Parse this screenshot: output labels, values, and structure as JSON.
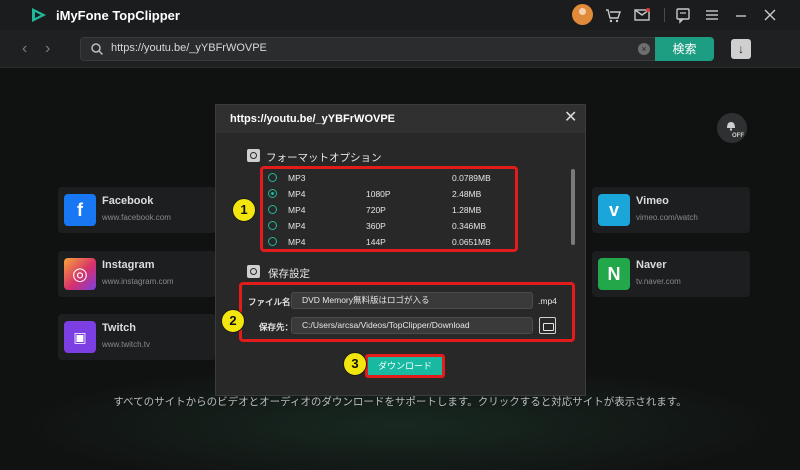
{
  "app": {
    "title": "iMyFone TopClipper",
    "brand_color": "#1d9d82",
    "icons": [
      "app-logo-icon",
      "cart-icon",
      "mail-icon",
      "feedback-icon",
      "menu-icon",
      "minimize-icon",
      "close-icon"
    ]
  },
  "addressbar": {
    "url": "https://youtu.be/_yYBFrWOVPE",
    "search_label": "検索"
  },
  "sites": [
    {
      "name": "Facebook",
      "url": "www.facebook.com",
      "logo": "f",
      "color": "#1877f2"
    },
    {
      "name": "Instagram",
      "url": "www.instagram.com",
      "logo": "◎",
      "color": "#d6306b"
    },
    {
      "name": "Twitch",
      "url": "www.twitch.tv",
      "logo": "▣",
      "color": "#7b3fe4"
    },
    {
      "name": "Vimeo",
      "url": "vimeo.com/watch",
      "logo": "v",
      "color": "#1aa6d9"
    },
    {
      "name": "Naver",
      "url": "tv.naver.com",
      "logo": "N",
      "color": "#22a84a"
    }
  ],
  "toggle": {
    "label": "OFF"
  },
  "bottom_text": "すべてのサイトからのビデオとオーディオのダウンロードをサポートします。クリックすると対応サイトが表示されます。",
  "modal": {
    "title": "https://youtu.be/_yYBFrWOVPE",
    "format_section_label": "フォーマットオプション",
    "formats": [
      {
        "type": "MP3",
        "resolution": "",
        "size": "0.0789MB",
        "selected": false
      },
      {
        "type": "MP4",
        "resolution": "1080P",
        "size": "2.48MB",
        "selected": true
      },
      {
        "type": "MP4",
        "resolution": "720P",
        "size": "1.28MB",
        "selected": false
      },
      {
        "type": "MP4",
        "resolution": "360P",
        "size": "0.346MB",
        "selected": false
      },
      {
        "type": "MP4",
        "resolution": "144P",
        "size": "0.0651MB",
        "selected": false
      }
    ],
    "save_section_label": "保存設定",
    "filename_label": "ファイル名：",
    "filename_value": "DVD Memory無料版はロゴが入る",
    "extension": ".mp4",
    "savepath_label": "保存先：",
    "savepath_value": "C:/Users/arcsa/Videos/TopClipper/Download",
    "download_label": "ダウンロード"
  },
  "annotations": {
    "step_1": "1",
    "step_2": "2",
    "step_3": "3",
    "highlight_color": "#e21b1b",
    "badge_color": "#f3e60e"
  }
}
